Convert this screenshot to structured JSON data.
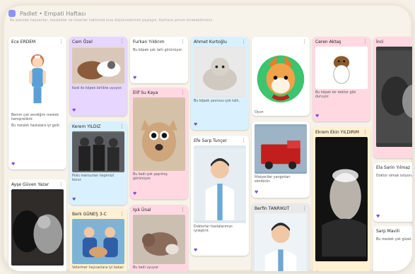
{
  "header": {
    "title": "Padlet • Empati Haftası",
    "subtitle": "Bu panoda hayvanlar, meslekler ve insanlar hakkında kısa düşüncelerinizi paylaşın. Kartlara yorum bırakabilirsiniz."
  },
  "cards": [
    {
      "title": "Ece ERDEM",
      "text": "Benim çok sevdiğim meslek hemşireliktir.",
      "text2": "Bu meslek hastalara iyi gelir.",
      "heart": "♥"
    },
    {
      "title": "Cem Özel",
      "text": "Kedi ile köpek birlikte uyuyor.",
      "heart": "♥"
    },
    {
      "title": "Furkan Yıldırım",
      "text": "Bu köpek çok tatlı görünüyor.",
      "heart": "♥"
    },
    {
      "title": "Ahmet Kurtoğlu",
      "text": "Bu köpek yavrusu çok tatlı.",
      "heart": "♥"
    },
    {
      "title": "",
      "text": "Oyun",
      "heart": ""
    },
    {
      "title": "Ceren Aktaş",
      "text": "Bu köpek bir doktor gibi duruyor.",
      "heart": "♥"
    },
    {
      "title": "İnci",
      "text": "",
      "heart": ""
    },
    {
      "title": "Elif Su Kaya",
      "text": "Bu kedi çok şaşırmış görünüyor.",
      "heart": "♥"
    },
    {
      "title": "Kerem YILDIZ",
      "text": "Polis memurları hepimizi korur.",
      "heart": "♥"
    },
    {
      "title": "Efe Sarp Tunçer",
      "text": "Doktorlar hastalarımızı iyileştirir.",
      "heart": "♥"
    },
    {
      "title": "",
      "text": "İtfaiyeciler yangınları söndürür.",
      "heart": "♥"
    },
    {
      "title": "Ekrem Ekin YILDIRIM",
      "text": "Bu yaşlı adam çok düşünceli görünüyor.",
      "heart": "♥"
    },
    {
      "title": "Ayşe Güven Yazar",
      "text": "Kedi ve köpek birbirine sarılmış.",
      "heart": "♥"
    },
    {
      "title": "Berk GÜNEŞ 3-C",
      "text": "Veteriner hayvanlara iyi bakar.",
      "heart": "♥"
    },
    {
      "title": "Işık Ünal",
      "text": "Bu kedi uyuyor.",
      "heart": "♥"
    },
    {
      "title": "Berfin TANRIKUT",
      "text": "",
      "heart": ""
    },
    {
      "title": "Ela Sarin Yılmaz",
      "text": "Doktor olmak istiyorum.",
      "heart": "♥"
    },
    {
      "title": "Sarp Mavili",
      "text": "Bu meslek çok güzel.",
      "heart": "♥"
    },
    {
      "title": "Yaren Okur",
      "text": "",
      "heart": ""
    }
  ],
  "colors": {
    "accent": "#7b4bd6",
    "pink": "#ffd8e2",
    "lilac": "#e7d6ff",
    "blue": "#d9f1ff",
    "cream": "#fff1d1"
  }
}
